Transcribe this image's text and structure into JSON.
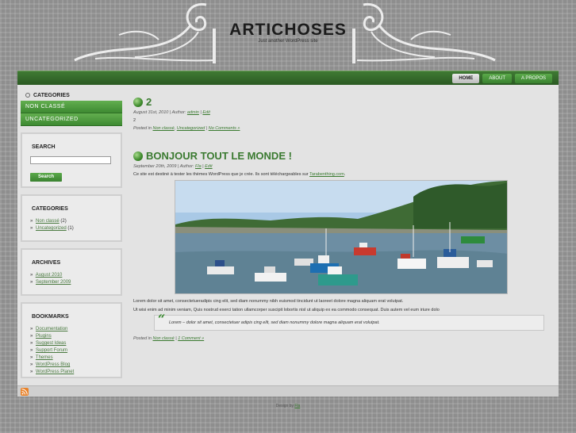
{
  "header": {
    "site_title": "ARTICHOSES",
    "site_description": "Just another WordPress site"
  },
  "nav": [
    {
      "label": "HOME",
      "active": true
    },
    {
      "label": "ABOUT",
      "active": false
    },
    {
      "label": "A PROPOS",
      "active": false
    }
  ],
  "sidebar": {
    "categories_top": {
      "title": "CATEGORIES",
      "items": [
        "NON CLASSÉ",
        "UNCATEGORIZED"
      ]
    },
    "search": {
      "title": "SEARCH",
      "button": "Search",
      "value": ""
    },
    "categories": {
      "title": "CATEGORIES",
      "items": [
        {
          "label": "Non classé",
          "count": "(2)"
        },
        {
          "label": "Uncategorized",
          "count": "(1)"
        }
      ]
    },
    "archives": {
      "title": "ARCHIVES",
      "items": [
        "August 2010",
        "September 2009"
      ]
    },
    "bookmarks": {
      "title": "BOOKMARKS",
      "items": [
        "Documentation",
        "Plugins",
        "Suggest Ideas",
        "Support Forum",
        "Themes",
        "WordPress Blog",
        "WordPress Planet"
      ]
    }
  },
  "posts": [
    {
      "title": "2",
      "date_prefix": "August 31st, 2010 | Author:",
      "author": "admin",
      "sep": "|",
      "edit": "Edit",
      "excerpt": "2",
      "posted_in": "Posted in",
      "categories": [
        "Non classé",
        "Uncategorized"
      ],
      "comments": "No Comments »"
    },
    {
      "title": "BONJOUR TOUT LE MONDE !",
      "date_prefix": "September 20th, 2009 | Author:",
      "author": "Fla",
      "sep": "|",
      "edit": "Edit",
      "intro": "Ce site est destiné à tester les thèmes WordPress que je crée. Ils sont téléchargeables sur",
      "intro_link": "Tarabenthing.com",
      "intro_end": ".",
      "lorem1": "Lorem dolor sit amet, consectetueradipis cing elit, sed diam nonummy nibh euismod tincidunt ut laoreet dolore magna aliquam erat volutpat.",
      "lorem2": "Ut wisi enim ad minim veniam, Quis nostrud exerci tation ullamcorper suscipit lobortis nisl ut aliquip ex ea commodo consequat. Duis autem vel eum iriure dolo",
      "quote": "Lorem – dolor sit amet, consectetuer adipis cing elit, sed diam nonummy dolore magna aliquam erat volutpat.",
      "posted_in": "Posted in",
      "category": "Non classé",
      "comments": "1 Comment »"
    }
  ],
  "footer": {
    "credit_prefix": "Design by",
    "credit_link": "Fla"
  },
  "colors": {
    "accent_green": "#3a7a30",
    "nav_bar": "#2b5a23",
    "content_bg": "#e3e3e3"
  }
}
